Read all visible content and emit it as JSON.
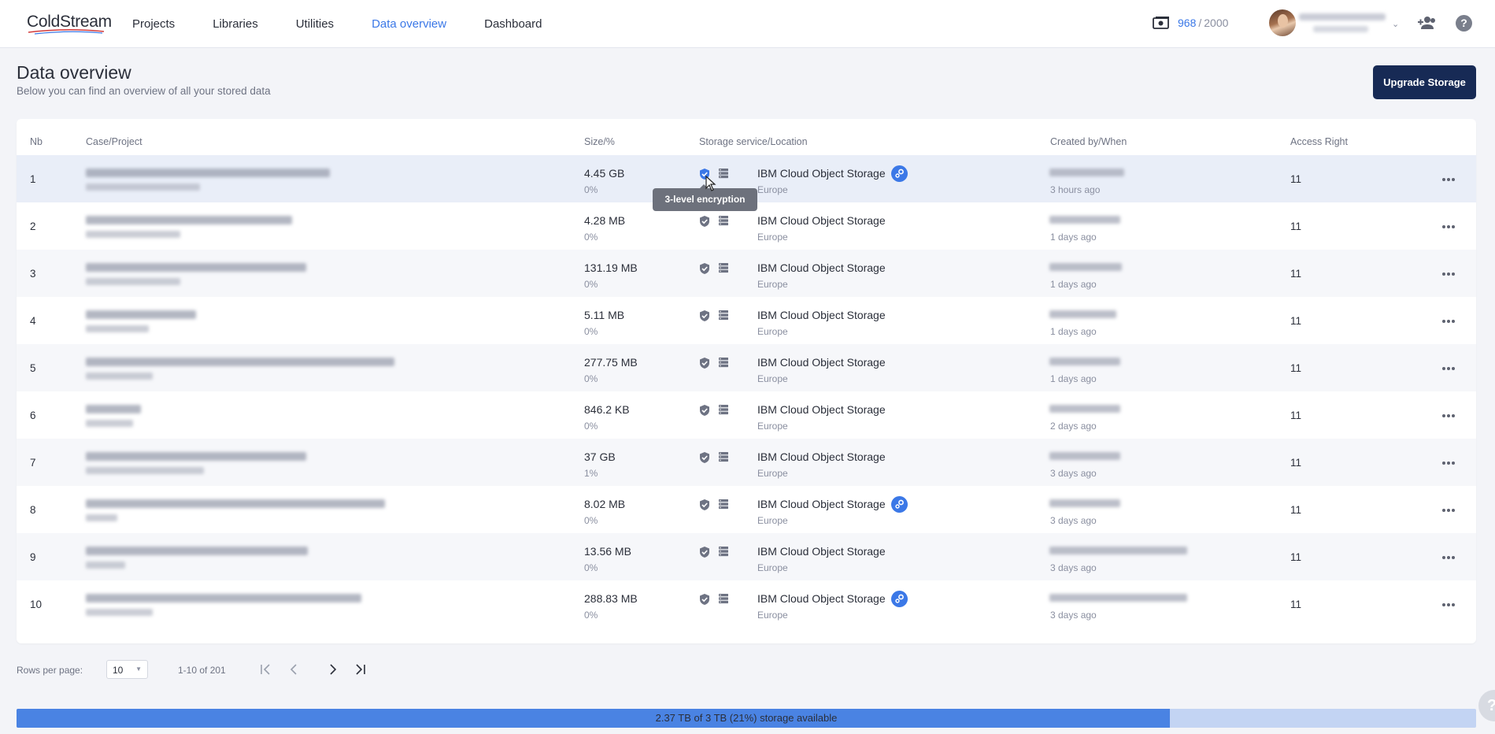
{
  "app": {
    "logo_text": "ColdStream"
  },
  "nav": {
    "items": [
      "Projects",
      "Libraries",
      "Utilities",
      "Data overview",
      "Dashboard"
    ],
    "active": "Data overview"
  },
  "credits": {
    "used": "968",
    "separator": "/",
    "total": "2000"
  },
  "header": {
    "title": "Data overview",
    "subtitle": "Below you can find an overview of all your stored data",
    "upgrade_label": "Upgrade Storage"
  },
  "table": {
    "columns": {
      "nb": "Nb",
      "case_project": "Case/Project",
      "size": "Size/%",
      "storage": "Storage service/Location",
      "created": "Created by/When",
      "access": "Access Right"
    },
    "rows": [
      {
        "nb": "1",
        "size": "4.45 GB",
        "pct": "0%",
        "service": "IBM Cloud Object Storage",
        "location": "Europe",
        "when": "3 hours ago",
        "access": "11",
        "badge": true,
        "highlight": true,
        "b1": 310,
        "b2": 145,
        "b3": 95
      },
      {
        "nb": "2",
        "size": "4.28 MB",
        "pct": "0%",
        "service": "IBM Cloud Object Storage",
        "location": "Europe",
        "when": "1 days ago",
        "access": "11",
        "badge": false,
        "b1": 262,
        "b2": 120,
        "b3": 90
      },
      {
        "nb": "3",
        "size": "131.19 MB",
        "pct": "0%",
        "service": "IBM Cloud Object Storage",
        "location": "Europe",
        "when": "1 days ago",
        "access": "11",
        "badge": false,
        "b1": 280,
        "b2": 120,
        "b3": 92
      },
      {
        "nb": "4",
        "size": "5.11 MB",
        "pct": "0%",
        "service": "IBM Cloud Object Storage",
        "location": "Europe",
        "when": "1 days ago",
        "access": "11",
        "badge": false,
        "b1": 140,
        "b2": 80,
        "b3": 85
      },
      {
        "nb": "5",
        "size": "277.75 MB",
        "pct": "0%",
        "service": "IBM Cloud Object Storage",
        "location": "Europe",
        "when": "1 days ago",
        "access": "11",
        "badge": false,
        "b1": 392,
        "b2": 85,
        "b3": 90
      },
      {
        "nb": "6",
        "size": "846.2 KB",
        "pct": "0%",
        "service": "IBM Cloud Object Storage",
        "location": "Europe",
        "when": "2 days ago",
        "access": "11",
        "badge": false,
        "b1": 70,
        "b2": 60,
        "b3": 90
      },
      {
        "nb": "7",
        "size": "37 GB",
        "pct": "1%",
        "service": "IBM Cloud Object Storage",
        "location": "Europe",
        "when": "3 days ago",
        "access": "11",
        "badge": false,
        "b1": 280,
        "b2": 150,
        "b3": 90
      },
      {
        "nb": "8",
        "size": "8.02 MB",
        "pct": "0%",
        "service": "IBM Cloud Object Storage",
        "location": "Europe",
        "when": "3 days ago",
        "access": "11",
        "badge": true,
        "b1": 380,
        "b2": 40,
        "b3": 90
      },
      {
        "nb": "9",
        "size": "13.56 MB",
        "pct": "0%",
        "service": "IBM Cloud Object Storage",
        "location": "Europe",
        "when": "3 days ago",
        "access": "11",
        "badge": false,
        "b1": 282,
        "b2": 50,
        "b3": 175
      },
      {
        "nb": "10",
        "size": "288.83 MB",
        "pct": "0%",
        "service": "IBM Cloud Object Storage",
        "location": "Europe",
        "when": "3 days ago",
        "access": "11",
        "badge": true,
        "b1": 350,
        "b2": 85,
        "b3": 175
      }
    ]
  },
  "tooltip": {
    "text": "3-level encryption"
  },
  "pagination": {
    "rows_label": "Rows per page:",
    "rows_value": "10",
    "range": "1-10 of 201"
  },
  "storage": {
    "text": "2.37 TB of  3 TB  (21%)  storage available",
    "fill_fraction": 0.79
  },
  "colors": {
    "accent": "#3b78e7",
    "brand_button": "#172a55",
    "storage_fill": "#4a83e3",
    "storage_track": "#c3d4f3"
  },
  "icons": [
    "credits-icon",
    "chevron-down-icon",
    "add-users-icon",
    "help-icon",
    "shield-check-icon",
    "database-icon",
    "gear-badge-icon",
    "more-horizontal-icon",
    "first-page-icon",
    "prev-page-icon",
    "next-page-icon",
    "last-page-icon"
  ]
}
